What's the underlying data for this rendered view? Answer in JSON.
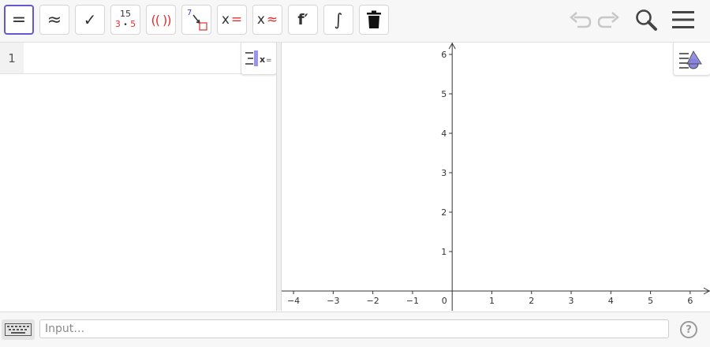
{
  "toolbar": {
    "buttons": [
      {
        "name": "evaluate-button",
        "label": "=",
        "active": true
      },
      {
        "name": "numeric-button",
        "label": "≈"
      },
      {
        "name": "check-button",
        "label": "✓"
      },
      {
        "name": "factor-button",
        "top": "15",
        "bottom_a": "3",
        "dot": "•",
        "bottom_b": "5"
      },
      {
        "name": "expand-button",
        "label": "(( ))"
      },
      {
        "name": "substitute-button",
        "label": "7"
      },
      {
        "name": "solve-button",
        "x": "x",
        "eq": "="
      },
      {
        "name": "nsolve-button",
        "x": "x",
        "eq": "≈"
      },
      {
        "name": "derivative-button",
        "label": "f′"
      },
      {
        "name": "integral-button",
        "label": "∫"
      },
      {
        "name": "delete-button",
        "label": ""
      }
    ],
    "right_icons": [
      "undo-icon",
      "redo-icon",
      "search-icon",
      "menu-icon"
    ]
  },
  "algebra": {
    "row_number": "1",
    "style_label": "x="
  },
  "graphics": {
    "x_ticks": [
      "−4",
      "−3",
      "−2",
      "−1",
      "0",
      "1",
      "2",
      "3",
      "4",
      "5",
      "6"
    ],
    "y_ticks": [
      "1",
      "2",
      "3",
      "4",
      "5",
      "6"
    ],
    "x_range": [
      -4.3,
      6.5
    ],
    "y_range": [
      -0.5,
      6.3
    ]
  },
  "input_bar": {
    "placeholder": "Input…"
  },
  "help": {
    "label": "?"
  },
  "colors": {
    "accent": "#6557d2",
    "red": "#e0312f"
  }
}
